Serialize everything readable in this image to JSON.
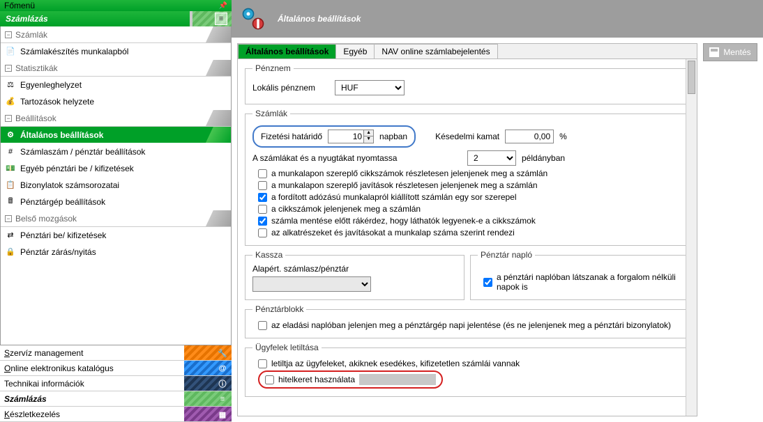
{
  "sidebar": {
    "main_menu": "Főmenü",
    "title": "Számlázás",
    "groups": [
      {
        "label": "Számlák"
      },
      {
        "label": "Statisztikák"
      },
      {
        "label": "Beállítások"
      },
      {
        "label": "Belső mozgások"
      }
    ],
    "items": {
      "szamlakeszites": "Számlakészítés munkalapból",
      "egyenleg": "Egyenleghelyzet",
      "tartozasok": "Tartozások helyzete",
      "altalanos": "Általános beállítások",
      "szamlaszam": "Számlaszám / pénztár beállítások",
      "egyeb_penztari": "Egyéb pénztári be / kifizetések",
      "bizonylatok": "Bizonylatok számsorozatai",
      "penztargep": "Pénztárgép beállítások",
      "penztari_beki": "Pénztári be/ kifizetések",
      "penztar_zaras": "Pénztár zárás/nyitás"
    },
    "bottom": {
      "szerviz": "Szervíz management",
      "online_kat": "Online elektronikus katalógus",
      "technikai": "Technikai információk",
      "szamlazas": "Számlázás",
      "keszlet": "Készletkezelés"
    }
  },
  "header": {
    "title": "Általános beállítások"
  },
  "tabs": {
    "t1": "Általános beállítások",
    "t2": "Egyéb",
    "t3": "NAV online számlabejelentés"
  },
  "form": {
    "penznem_legend": "Pénznem",
    "lokalis_label": "Lokális pénznem",
    "currency": "HUF",
    "szamlak_legend": "Számlák",
    "fiz_hatarido": "Fizetési határidő",
    "fiz_value": "10",
    "napban": "napban",
    "kesedelmi": "Késedelmi kamat",
    "kamat_value": "0,00",
    "percent": "%",
    "nyomtassa": "A számlákat és a nyugtákat nyomtassa",
    "peldany_value": "2",
    "peldanyban": "példányban",
    "chk1": "a munkalapon szereplő cikkszámok részletesen jelenjenek meg a számlán",
    "chk2": "a munkalapon szereplő javítások részletesen jelenjenek meg a számlán",
    "chk3": "a fordított adózású munkalapról kiállított számlán egy sor szerepel",
    "chk4": "a cikkszámok jelenjenek meg a számlán",
    "chk5": "számla mentése előtt rákérdez, hogy láthatók legyenek-e a cikkszámok",
    "chk6": "az alkatrészeket és javításokat a munkalap száma szerint rendezi",
    "kassza_legend": "Kassza",
    "kassza_label": "Alapért. számlasz/pénztár",
    "naplo_legend": "Pénztár napló",
    "naplo_chk": "a pénztári naplóban látszanak a forgalom nélküli napok is",
    "pblokk_legend": "Pénztárblokk",
    "pblokk_chk": "az eladási naplóban jelenjen meg a pénztárgép napi jelentése (és ne jelenjenek meg a pénztári bizonylatok)",
    "ugyfel_legend": "Ügyfelek letiltása",
    "ugyfel_chk1": "letiltja az ügyfeleket, akiknek esedékes, kifizetetlen számlái vannak",
    "ugyfel_chk2": "hitelkeret használata"
  },
  "buttons": {
    "save": "Mentés"
  }
}
